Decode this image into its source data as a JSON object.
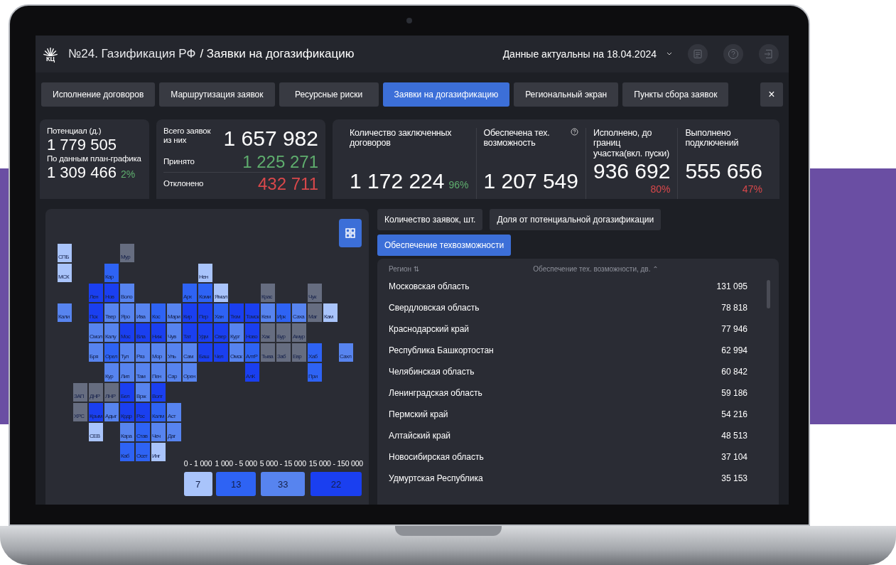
{
  "header": {
    "logo_text": "КЦ",
    "title": "№24. Газификация РФ",
    "subtitle": "/ Заявки на догазификацию",
    "date": "Данные актуальны на 18.04.2024"
  },
  "tabs": [
    {
      "label": "Исполнение договоров",
      "selected": false
    },
    {
      "label": "Маршрутизация заявок",
      "selected": false
    },
    {
      "label": "Ресурсные риски",
      "selected": false
    },
    {
      "label": "Заявки на догазификацию",
      "selected": true
    },
    {
      "label": "Региональный экран",
      "selected": false
    },
    {
      "label": "Пункты сбора заявок",
      "selected": false
    }
  ],
  "close_label": "×",
  "potential": {
    "label": "Потенциал (д.)",
    "value": "1 779 505",
    "plan_label": "По данным план-графика",
    "plan_value": "1 309 466",
    "plan_percent": "2%"
  },
  "requests": {
    "label": "Всего заявок из них",
    "value": "1 657 982",
    "rows": [
      {
        "label": "Принято",
        "value": "1 225 271",
        "color": "#5fae6e"
      },
      {
        "label": "Отклонено",
        "value": "432 711",
        "color": "#d9484b"
      }
    ]
  },
  "metrics": [
    {
      "label": "Количество заключенных договоров",
      "value": "1 172 224",
      "percent": "96%",
      "color": "#5fae6e",
      "help": false
    },
    {
      "label": "Обеспечена тех. возможность",
      "value": "1 207 549",
      "help": true
    },
    {
      "label": "Исполнено, до границ участка(вкл. пуски)",
      "value": "936 692",
      "percent": "80%",
      "color": "#d9484b",
      "help": false
    },
    {
      "label": "Выполнено подключений",
      "value": "555 656",
      "percent": "47%",
      "color": "#d9484b",
      "help": false
    }
  ],
  "map": {
    "rows": [
      [
        {
          "kind": "tile",
          "label": "СПБ",
          "color": "#a9c4fb"
        },
        {
          "kind": "gap"
        },
        {
          "kind": "gap"
        },
        {
          "kind": "gap"
        },
        {
          "kind": "tile",
          "label": "Мур",
          "color": "#666d80"
        }
      ],
      [
        {
          "kind": "tile",
          "label": "МСК",
          "color": "#a9c4fb"
        },
        {
          "kind": "gap"
        },
        {
          "kind": "gap"
        },
        {
          "kind": "tile",
          "label": "Кар",
          "color": "#2e63f4"
        },
        {
          "kind": "gap"
        },
        {
          "kind": "gap"
        },
        {
          "kind": "gap"
        },
        {
          "kind": "gap"
        },
        {
          "kind": "gap"
        },
        {
          "kind": "tile",
          "label": "Нен",
          "color": "#a9c4fb"
        }
      ],
      [
        {
          "kind": "gap"
        },
        {
          "kind": "gap"
        },
        {
          "kind": "tile",
          "label": "Лен",
          "color": "#1a3ff0"
        },
        {
          "kind": "tile",
          "label": "Нов",
          "color": "#1a3ff0"
        },
        {
          "kind": "tile",
          "label": "Воло",
          "color": "#5784ef"
        },
        {
          "kind": "gap"
        },
        {
          "kind": "gap"
        },
        {
          "kind": "gap"
        },
        {
          "kind": "tile",
          "label": "Арх",
          "color": "#2e63f4"
        },
        {
          "kind": "tile",
          "label": "Коми",
          "color": "#2e63f4"
        },
        {
          "kind": "tile",
          "label": "Ямал",
          "color": "#a9c4fb"
        },
        {
          "kind": "gap"
        },
        {
          "kind": "gap"
        },
        {
          "kind": "tile",
          "label": "Крас",
          "color": "#666d80"
        },
        {
          "kind": "gap"
        },
        {
          "kind": "gap"
        },
        {
          "kind": "tile",
          "label": "Чук",
          "color": "#666d80"
        }
      ],
      [
        {
          "kind": "tile",
          "label": "Кали",
          "color": "#5784ef"
        },
        {
          "kind": "gap"
        },
        {
          "kind": "tile",
          "label": "Пск",
          "color": "#1a3ff0"
        },
        {
          "kind": "tile",
          "label": "Твер",
          "color": "#5784ef"
        },
        {
          "kind": "tile",
          "label": "Яро",
          "color": "#5784ef"
        },
        {
          "kind": "tile",
          "label": "Ива",
          "color": "#5784ef"
        },
        {
          "kind": "tile",
          "label": "Кос",
          "color": "#2e63f4"
        },
        {
          "kind": "tile",
          "label": "Мари",
          "color": "#5784ef"
        },
        {
          "kind": "tile",
          "label": "Кир",
          "color": "#1a3ff0"
        },
        {
          "kind": "tile",
          "label": "Пер",
          "color": "#1a3ff0"
        },
        {
          "kind": "tile",
          "label": "Хан",
          "color": "#2e63f4"
        },
        {
          "kind": "tile",
          "label": "Тюм",
          "color": "#1a3ff0"
        },
        {
          "kind": "tile",
          "label": "Томск",
          "color": "#1a3ff0"
        },
        {
          "kind": "tile",
          "label": "Кем",
          "color": "#5784ef"
        },
        {
          "kind": "tile",
          "label": "Ирк",
          "color": "#2e63f4"
        },
        {
          "kind": "tile",
          "label": "Саха",
          "color": "#5784ef"
        },
        {
          "kind": "tile",
          "label": "Маг",
          "color": "#666d80"
        },
        {
          "kind": "tile",
          "label": "Кам",
          "color": "#a9c4fb"
        }
      ],
      [
        {
          "kind": "gap"
        },
        {
          "kind": "gap"
        },
        {
          "kind": "tile",
          "label": "Смол",
          "color": "#5784ef"
        },
        {
          "kind": "tile",
          "label": "Калу",
          "color": "#5784ef"
        },
        {
          "kind": "tile",
          "label": "Мос",
          "color": "#1a3ff0"
        },
        {
          "kind": "tile",
          "label": "Вла",
          "color": "#1a3ff0"
        },
        {
          "kind": "tile",
          "label": "Ниж",
          "color": "#1a3ff0"
        },
        {
          "kind": "tile",
          "label": "Чув",
          "color": "#5784ef"
        },
        {
          "kind": "tile",
          "label": "Тат",
          "color": "#1a3ff0"
        },
        {
          "kind": "tile",
          "label": "Удм",
          "color": "#1a3ff0"
        },
        {
          "kind": "tile",
          "label": "Свер",
          "color": "#1a3ff0"
        },
        {
          "kind": "tile",
          "label": "Кург",
          "color": "#5784ef"
        },
        {
          "kind": "tile",
          "label": "Ново",
          "color": "#1a3ff0"
        },
        {
          "kind": "tile",
          "label": "Хак",
          "color": "#666d80"
        },
        {
          "kind": "tile",
          "label": "Бур",
          "color": "#666d80"
        },
        {
          "kind": "tile",
          "label": "Амур",
          "color": "#666d80"
        }
      ],
      [
        {
          "kind": "gap"
        },
        {
          "kind": "gap"
        },
        {
          "kind": "tile",
          "label": "Бря",
          "color": "#5784ef"
        },
        {
          "kind": "tile",
          "label": "Орел",
          "color": "#2e63f4"
        },
        {
          "kind": "tile",
          "label": "Тул",
          "color": "#5784ef"
        },
        {
          "kind": "tile",
          "label": "Ряз",
          "color": "#5784ef"
        },
        {
          "kind": "tile",
          "label": "Мор",
          "color": "#5784ef"
        },
        {
          "kind": "tile",
          "label": "Уль",
          "color": "#5784ef"
        },
        {
          "kind": "tile",
          "label": "Сам",
          "color": "#5784ef"
        },
        {
          "kind": "tile",
          "label": "Баш",
          "color": "#1a3ff0"
        },
        {
          "kind": "tile",
          "label": "Чел",
          "color": "#1a3ff0"
        },
        {
          "kind": "tile",
          "label": "Омск",
          "color": "#5784ef"
        },
        {
          "kind": "tile",
          "label": "АлтР",
          "color": "#2e63f4"
        },
        {
          "kind": "tile",
          "label": "Тыва",
          "color": "#666d80"
        },
        {
          "kind": "tile",
          "label": "Заб",
          "color": "#666d80"
        },
        {
          "kind": "tile",
          "label": "Евр",
          "color": "#666d80"
        },
        {
          "kind": "tile",
          "label": "Хаб",
          "color": "#2e63f4"
        },
        {
          "kind": "gap"
        },
        {
          "kind": "tile",
          "label": "Сахл",
          "color": "#5784ef"
        }
      ],
      [
        {
          "kind": "gap"
        },
        {
          "kind": "gap"
        },
        {
          "kind": "gap"
        },
        {
          "kind": "tile",
          "label": "Кур",
          "color": "#5784ef"
        },
        {
          "kind": "tile",
          "label": "Лип",
          "color": "#5784ef"
        },
        {
          "kind": "tile",
          "label": "Там",
          "color": "#5784ef"
        },
        {
          "kind": "tile",
          "label": "Пен",
          "color": "#5784ef"
        },
        {
          "kind": "tile",
          "label": "Сар",
          "color": "#5784ef"
        },
        {
          "kind": "tile",
          "label": "Орен",
          "color": "#5784ef"
        },
        {
          "kind": "gap"
        },
        {
          "kind": "gap"
        },
        {
          "kind": "gap"
        },
        {
          "kind": "tile",
          "label": "АлК",
          "color": "#1a3ff0"
        },
        {
          "kind": "gap"
        },
        {
          "kind": "gap"
        },
        {
          "kind": "gap"
        },
        {
          "kind": "tile",
          "label": "При",
          "color": "#2e63f4"
        }
      ],
      [
        {
          "kind": "gap"
        },
        {
          "kind": "tile",
          "label": "ЗАП",
          "color": "#666d80"
        },
        {
          "kind": "tile",
          "label": "ДНР",
          "color": "#666d80"
        },
        {
          "kind": "tile",
          "label": "ЛНР",
          "color": "#666d80"
        },
        {
          "kind": "tile",
          "label": "Бел",
          "color": "#1a3ff0"
        },
        {
          "kind": "tile",
          "label": "Врж",
          "color": "#5784ef"
        },
        {
          "kind": "tile",
          "label": "Волг",
          "color": "#1a3ff0"
        }
      ],
      [
        {
          "kind": "gap"
        },
        {
          "kind": "tile",
          "label": "ХРС",
          "color": "#666d80"
        },
        {
          "kind": "tile",
          "label": "Крым",
          "color": "#1a3ff0"
        },
        {
          "kind": "tile",
          "label": "Адыг",
          "color": "#5784ef"
        },
        {
          "kind": "tile",
          "label": "Крдр",
          "color": "#1a3ff0"
        },
        {
          "kind": "tile",
          "label": "Рос",
          "color": "#1a3ff0"
        },
        {
          "kind": "tile",
          "label": "Калм",
          "color": "#2e63f4"
        },
        {
          "kind": "tile",
          "label": "Аст",
          "color": "#5784ef"
        }
      ],
      [
        {
          "kind": "gap"
        },
        {
          "kind": "gap"
        },
        {
          "kind": "tile",
          "label": "СЕВ",
          "color": "#a9c4fb"
        },
        {
          "kind": "gap"
        },
        {
          "kind": "tile",
          "label": "Кара",
          "color": "#5784ef"
        },
        {
          "kind": "tile",
          "label": "Став",
          "color": "#2e63f4"
        },
        {
          "kind": "tile",
          "label": "Чеч",
          "color": "#5784ef"
        },
        {
          "kind": "tile",
          "label": "Даг",
          "color": "#5784ef"
        }
      ],
      [
        {
          "kind": "gap"
        },
        {
          "kind": "gap"
        },
        {
          "kind": "gap"
        },
        {
          "kind": "gap"
        },
        {
          "kind": "tile",
          "label": "Каб",
          "color": "#2e63f4"
        },
        {
          "kind": "tile",
          "label": "Осет",
          "color": "#2e63f4"
        },
        {
          "kind": "tile",
          "label": "Инг",
          "color": "#a9c4fb"
        }
      ]
    ],
    "legend": [
      {
        "range": "0 - 1 000",
        "count": "7",
        "color": "#a9c4fb"
      },
      {
        "range": "1 000 - 5 000",
        "count": "13",
        "color": "#2e63f4"
      },
      {
        "range": "5 000 - 15 000",
        "count": "33",
        "color": "#5784ef"
      },
      {
        "range": "15 000 - 150 000",
        "count": "22",
        "color": "#1a3ff0"
      }
    ]
  },
  "views": [
    {
      "label": "Количество заявок, шт.",
      "selected": false
    },
    {
      "label": "Доля от потенциальной догазификации",
      "selected": false
    },
    {
      "label": "Обеспечение техвозможности",
      "selected": true
    }
  ],
  "table": {
    "columns": [
      "Регион ⇅",
      "Обеспечение тех. возможности, дв. ⌃"
    ],
    "rows": [
      {
        "region": "Московская область",
        "value": "131 095"
      },
      {
        "region": "Свердловская область",
        "value": "78 818"
      },
      {
        "region": "Краснодарский край",
        "value": "77 946"
      },
      {
        "region": "Республика Башкортостан",
        "value": "62 994"
      },
      {
        "region": "Челябинская область",
        "value": "60 842"
      },
      {
        "region": "Ленинградская область",
        "value": "59 186"
      },
      {
        "region": "Пермский край",
        "value": "54 216"
      },
      {
        "region": "Алтайский край",
        "value": "48 513"
      },
      {
        "region": "Новосибирская область",
        "value": "37 104"
      },
      {
        "region": "Удмуртская Республика",
        "value": "35 153"
      }
    ]
  }
}
